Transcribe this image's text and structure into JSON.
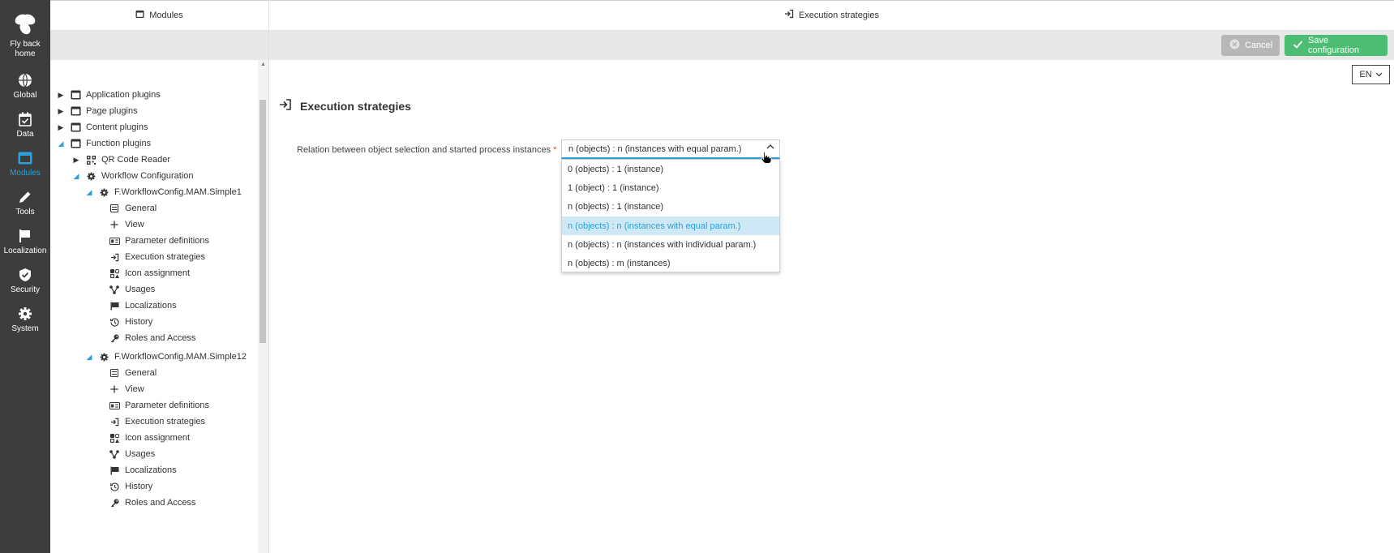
{
  "rail": {
    "home_label": "Fly back home",
    "items": [
      {
        "label": "Global",
        "icon": "globe-icon"
      },
      {
        "label": "Data",
        "icon": "calendar-check-icon"
      },
      {
        "label": "Modules",
        "icon": "window-icon",
        "active": true
      },
      {
        "label": "Tools",
        "icon": "pencil-icon"
      },
      {
        "label": "Localization",
        "icon": "flag-icon"
      },
      {
        "label": "Security",
        "icon": "shield-check-icon"
      },
      {
        "label": "System",
        "icon": "gear-icon"
      }
    ]
  },
  "tabs": {
    "left": "Modules",
    "right": "Execution strategies"
  },
  "toolbar": {
    "cancel_label": "Cancel",
    "save_label": "Save configuration"
  },
  "language": "EN",
  "tree": [
    {
      "label": "Application plugins",
      "level": 0,
      "state": "closed",
      "icon": "window-icon"
    },
    {
      "label": "Page plugins",
      "level": 0,
      "state": "closed",
      "icon": "window-icon"
    },
    {
      "label": "Content plugins",
      "level": 0,
      "state": "closed",
      "icon": "window-icon"
    },
    {
      "label": "Function plugins",
      "level": 0,
      "state": "open",
      "icon": "window-icon"
    },
    {
      "label": "QR Code Reader",
      "level": 1,
      "state": "closed",
      "icon": "qr-icon"
    },
    {
      "label": "Workflow Configuration",
      "level": 1,
      "state": "open",
      "icon": "gear-icon"
    },
    {
      "label": "F.WorkflowConfig.MAM.Simple1",
      "level": 2,
      "state": "open",
      "icon": "gear-icon"
    },
    {
      "label": "General",
      "level": 3,
      "icon": "form-icon"
    },
    {
      "label": "View",
      "level": 3,
      "icon": "plus-icon"
    },
    {
      "label": "Parameter definitions",
      "level": 3,
      "icon": "param-icon"
    },
    {
      "label": "Execution strategies",
      "level": 3,
      "icon": "sign-in-icon"
    },
    {
      "label": "Icon assignment",
      "level": 3,
      "icon": "icon-assign-icon"
    },
    {
      "label": "Usages",
      "level": 3,
      "icon": "share-nodes-icon"
    },
    {
      "label": "Localizations",
      "level": 3,
      "icon": "flag-icon"
    },
    {
      "label": "History",
      "level": 3,
      "icon": "history-icon"
    },
    {
      "label": "Roles and Access",
      "level": 3,
      "icon": "key-icon"
    },
    {
      "label": "F.WorkflowConfig.MAM.Simple12",
      "level": 2,
      "state": "open",
      "icon": "gear-icon"
    },
    {
      "label": "General",
      "level": 3,
      "icon": "form-icon"
    },
    {
      "label": "View",
      "level": 3,
      "icon": "plus-icon"
    },
    {
      "label": "Parameter definitions",
      "level": 3,
      "icon": "param-icon"
    },
    {
      "label": "Execution strategies",
      "level": 3,
      "icon": "sign-in-icon"
    },
    {
      "label": "Icon assignment",
      "level": 3,
      "icon": "icon-assign-icon"
    },
    {
      "label": "Usages",
      "level": 3,
      "icon": "share-nodes-icon"
    },
    {
      "label": "Localizations",
      "level": 3,
      "icon": "flag-icon"
    },
    {
      "label": "History",
      "level": 3,
      "icon": "history-icon"
    },
    {
      "label": "Roles and Access",
      "level": 3,
      "icon": "key-icon"
    }
  ],
  "main": {
    "title": "Execution strategies",
    "field_label": "Relation between object selection and started process instances",
    "required_mark": "*",
    "selected_value": "n (objects) : n (instances with equal param.)",
    "options": [
      "0 (objects) : 1 (instance)",
      "1 (object) : 1 (instance)",
      "n (objects) : 1 (instance)",
      "n (objects) : n (instances with equal param.)",
      "n (objects) : n (instances with individual param.)",
      "n (objects) : m (instances)"
    ],
    "selected_index": 3
  },
  "colors": {
    "accent": "#2aa1d8",
    "rail_bg": "#3d3d3d",
    "save_bg": "#4dbd74",
    "cancel_bg": "#b7b7b7"
  }
}
